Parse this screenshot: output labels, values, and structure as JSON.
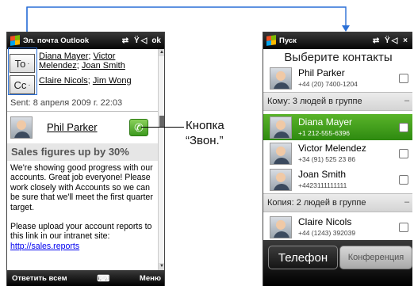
{
  "left_phone": {
    "title": "Эл. почта Outlook",
    "status_icons": "⇄ Ÿ◁",
    "ok_label": "ok",
    "to_button": "To",
    "cc_button": "Cc",
    "to_recipients": [
      "Diana Mayer",
      "Victor Melendez",
      "Joan Smith"
    ],
    "cc_recipients": [
      "Claire Nicols",
      "Jim Wong"
    ],
    "sent": "Sent: 8 апреля 2009 г. 22:03",
    "sender_name": "Phil Parker",
    "subject": "Sales figures up by 30%",
    "body_paragraph_1": "We're showing good progress with our accounts. Great job everyone! Please work closely with Accounts so we can be sure that we'll meet the first quarter target.",
    "body_paragraph_2": "Please upload your account reports to this link in our intranet site: ",
    "link": "http://sales.reports",
    "softkey_left": "Ответить всем",
    "softkey_right": "Меню"
  },
  "callout": {
    "line1": "Кнопка",
    "line2": "“Звон.”"
  },
  "right_phone": {
    "title": "Пуск",
    "status_icons": "⇄ Ÿ◁ ×",
    "header": "Выберите контакты",
    "contacts_top": [
      {
        "name": "Phil Parker",
        "phone": "+44 (20) 7400-1204"
      }
    ],
    "group_to": "Кому: 3 людей в группе",
    "contacts_to": [
      {
        "name": "Diana Mayer",
        "phone": "+1 212-555-6396",
        "selected": true
      },
      {
        "name": "Victor Melendez",
        "phone": "+34 (91) 525 23 86",
        "selected": false
      },
      {
        "name": "Joan Smith",
        "phone": "+4423111111111",
        "selected": false
      }
    ],
    "group_cc": "Копия: 2 людей в группе",
    "contacts_cc": [
      {
        "name": "Claire Nicols",
        "phone": "+44 (1243) 392039"
      }
    ],
    "group_collapse": "–",
    "btn_phone": "Телефон",
    "btn_conference": "Конференция"
  }
}
